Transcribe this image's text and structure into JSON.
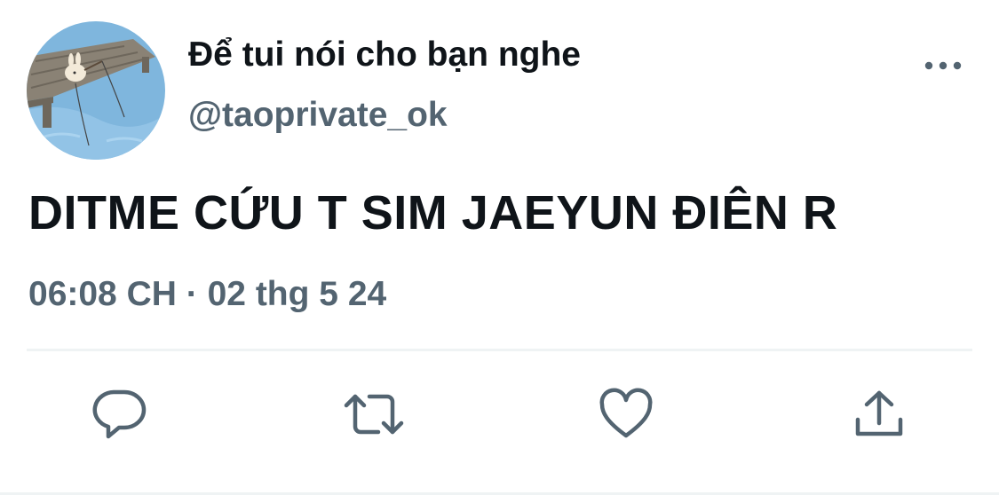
{
  "author": {
    "display_name": "Để tui nói cho bạn nghe",
    "handle": "@taoprivate_ok",
    "avatar_icon": "bunny-fishing-on-pier-avatar"
  },
  "tweet": {
    "text": "DITME CỨU T SIM JAEYUN ĐIÊN R",
    "time": "06:08 CH",
    "separator": "·",
    "date": "02 thg 5 24"
  },
  "actions": [
    {
      "name": "reply",
      "icon": "speech-bubble-icon"
    },
    {
      "name": "retweet",
      "icon": "retweet-arrows-icon"
    },
    {
      "name": "like",
      "icon": "heart-icon"
    },
    {
      "name": "share",
      "icon": "share-upload-icon"
    }
  ],
  "colors": {
    "text_primary": "#0f1419",
    "text_secondary": "#536471",
    "divider": "#eff3f4"
  }
}
